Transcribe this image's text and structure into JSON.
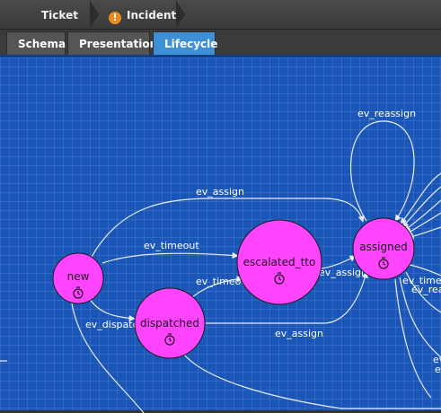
{
  "breadcrumb": {
    "items": [
      "Ticket",
      "Incident"
    ]
  },
  "tabs": [
    "Schema",
    "Presentation",
    "Lifecycle"
  ],
  "active_tab": "Lifecycle",
  "lifecycle": {
    "states": {
      "new": "new",
      "dispatched": "dispatched",
      "escalated_tto": "escalated_tto",
      "assigned": "assigned"
    },
    "edges": {
      "e1": "ev_assign",
      "e2": "ev_timeout",
      "e3": "ev_timeout",
      "e4": "ev_assign",
      "e5": "ev_assign",
      "e6": "ev_dispatch",
      "e7": "ev_reassign",
      "e8": "ev_timeout",
      "e9": "ev_reassign",
      "e10": "ev",
      "e11": "ev"
    }
  },
  "colors": {
    "canvas": "#1a56b8",
    "state_fill": "#ff44ff",
    "active_tab": "#3d8fd6"
  }
}
